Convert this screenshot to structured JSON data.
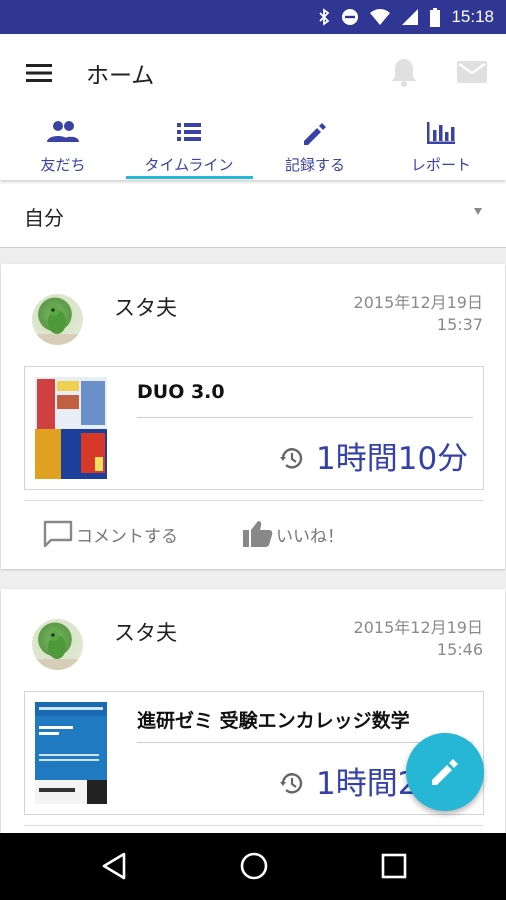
{
  "status_bar": {
    "time": "15:18",
    "icons": [
      "bluetooth-icon",
      "do-not-disturb-icon",
      "wifi-icon",
      "signal-icon",
      "battery-icon"
    ]
  },
  "app_bar": {
    "title": "ホーム",
    "icons": [
      "menu-icon",
      "bell-icon",
      "mail-icon"
    ]
  },
  "tabs": [
    {
      "label": "友だち",
      "icon": "people-icon"
    },
    {
      "label": "タイムライン",
      "icon": "list-icon",
      "selected": true
    },
    {
      "label": "記録する",
      "icon": "pencil-icon"
    },
    {
      "label": "レポート",
      "icon": "bar-chart-icon"
    }
  ],
  "filter": {
    "selected": "自分"
  },
  "posts": [
    {
      "user": "スタ夫",
      "date": "2015年12月19日",
      "time": "15:37",
      "book_title": "DUO 3.0",
      "duration": "1時間10分",
      "comment_label": "コメントする",
      "like_label": "いいね！"
    },
    {
      "user": "スタ夫",
      "date": "2015年12月19日",
      "time": "15:46",
      "book_title": "進研ゼミ 受験エンカレッジ数学",
      "duration": "1時間2"
    }
  ],
  "colors": {
    "status_bar": "#2f3693",
    "accent": "#26b6d6",
    "primary_text": "#3441a8"
  }
}
